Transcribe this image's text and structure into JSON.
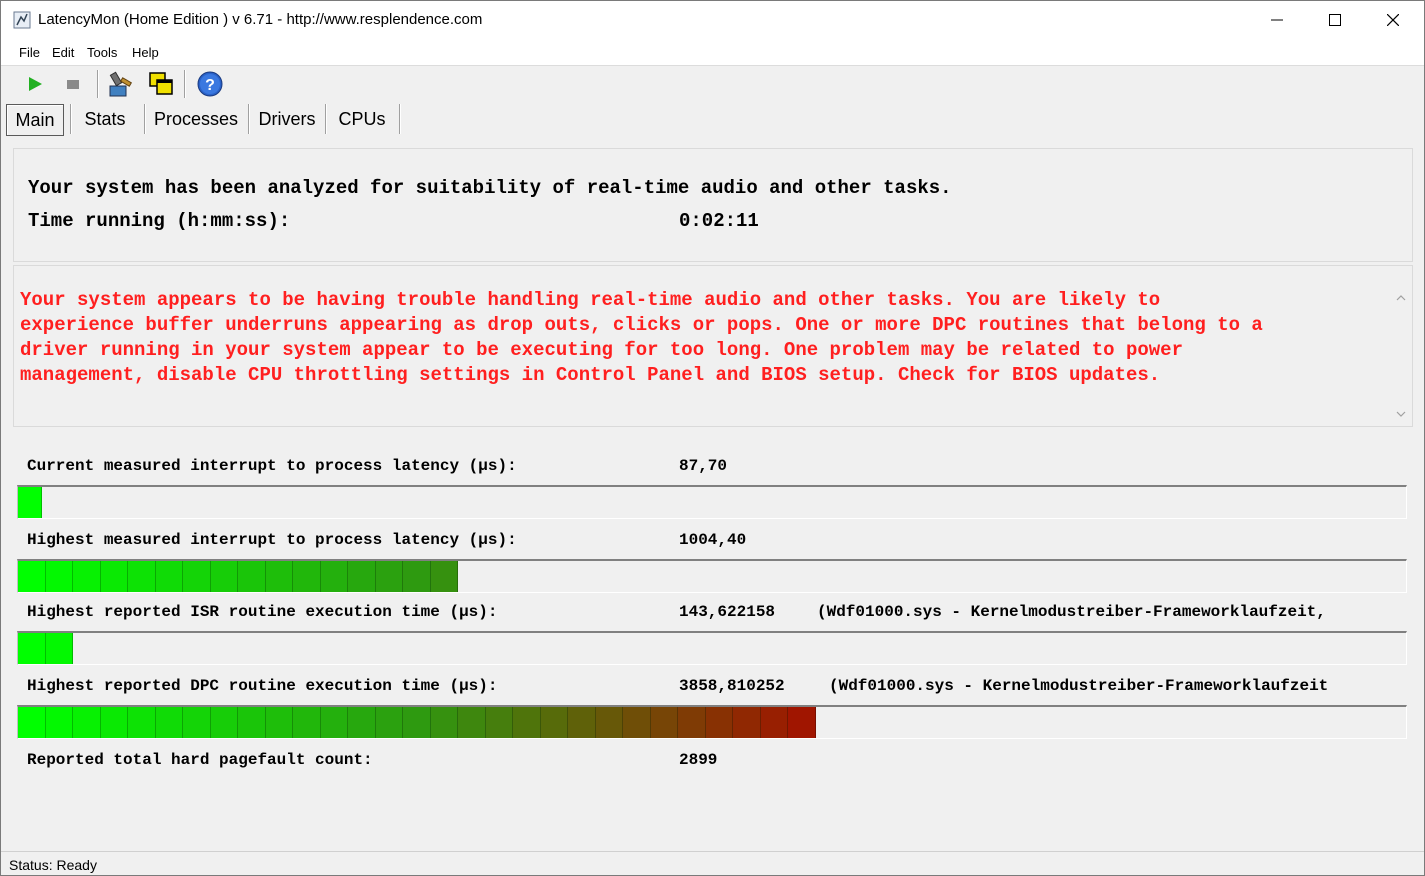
{
  "window": {
    "title": "LatencyMon  (Home Edition )  v 6.71 - http://www.resplendence.com"
  },
  "menu": {
    "file": "File",
    "edit": "Edit",
    "tools": "Tools",
    "help": "Help"
  },
  "tabs": [
    "Main",
    "Stats",
    "Processes",
    "Drivers",
    "CPUs"
  ],
  "summary": {
    "headline": "Your system has been analyzed for suitability of real-time audio and other tasks.",
    "time_label": "Time running (h:mm:ss):",
    "time_value": "0:02:11"
  },
  "warning": {
    "text": "Your system appears to be having trouble handling real-time audio and other tasks. You are likely to\nexperience buffer underruns appearing as drop outs, clicks or pops. One or more DPC routines that belong to a\ndriver running in your system appear to be executing for too long. One problem may be related to power\nmanagement, disable CPU throttling settings in Control Panel and BIOS setup. Check for BIOS updates.",
    "color": "#ff1f1f"
  },
  "metrics": [
    {
      "label": "Current measured interrupt to process latency (µs):",
      "value": "87,70",
      "extra": "",
      "segments": 1
    },
    {
      "label": "Highest measured interrupt to process latency (µs):",
      "value": "1004,40",
      "extra": "",
      "segments": 16
    },
    {
      "label": "Highest reported ISR routine execution time (µs):",
      "value": "143,622158",
      "extra": "(Wdf01000.sys - Kernelmodustreiber-Frameworklaufzeit,",
      "segments": 2
    },
    {
      "label": "Highest reported DPC routine execution time (µs):",
      "value": "3858,810252",
      "extra": "(Wdf01000.sys - Kernelmodustreiber-Frameworklaufzeit",
      "segments": 29
    }
  ],
  "pagefault": {
    "label": "Reported total hard pagefault count:",
    "value": "2899"
  },
  "status": {
    "text": "Status: Ready"
  },
  "colors": {
    "bar_start": "#00ff00",
    "bar_mid": "#2e9a10",
    "bar_end": "#a01500"
  }
}
